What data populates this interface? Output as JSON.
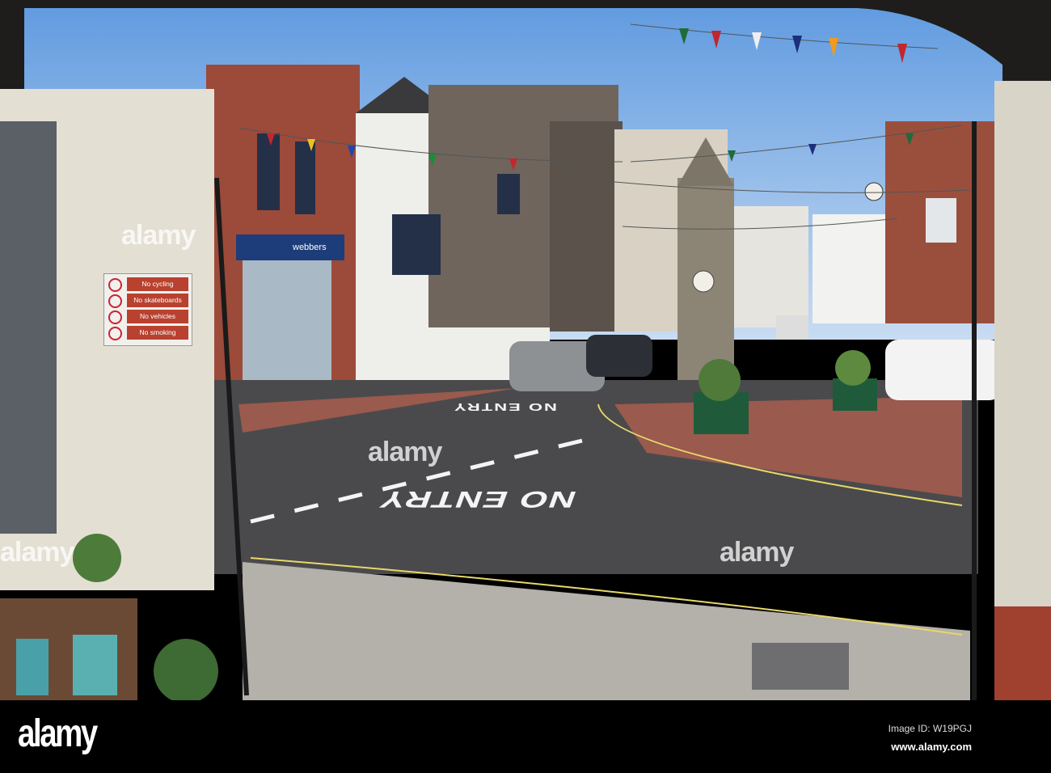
{
  "photo": {
    "sign": {
      "lines": [
        "No cycling",
        "No skateboards",
        "No vehicles",
        "No smoking"
      ]
    },
    "shop_name": "webbers",
    "road_markings": [
      "NO ENTRY",
      "NO ENTRY"
    ],
    "watermarks": [
      "alamy",
      "alamy",
      "alamy",
      "alamy"
    ]
  },
  "footer": {
    "logo": "alamy",
    "image_id": "Image ID: W19PGJ",
    "url": "www.alamy.com"
  },
  "colors": {
    "sky": "#7fb0e6",
    "road": "#4a4a4c",
    "pavement": "#b4b0aa",
    "brick": "#9c4a3a",
    "arch": "#1e1d1b"
  }
}
